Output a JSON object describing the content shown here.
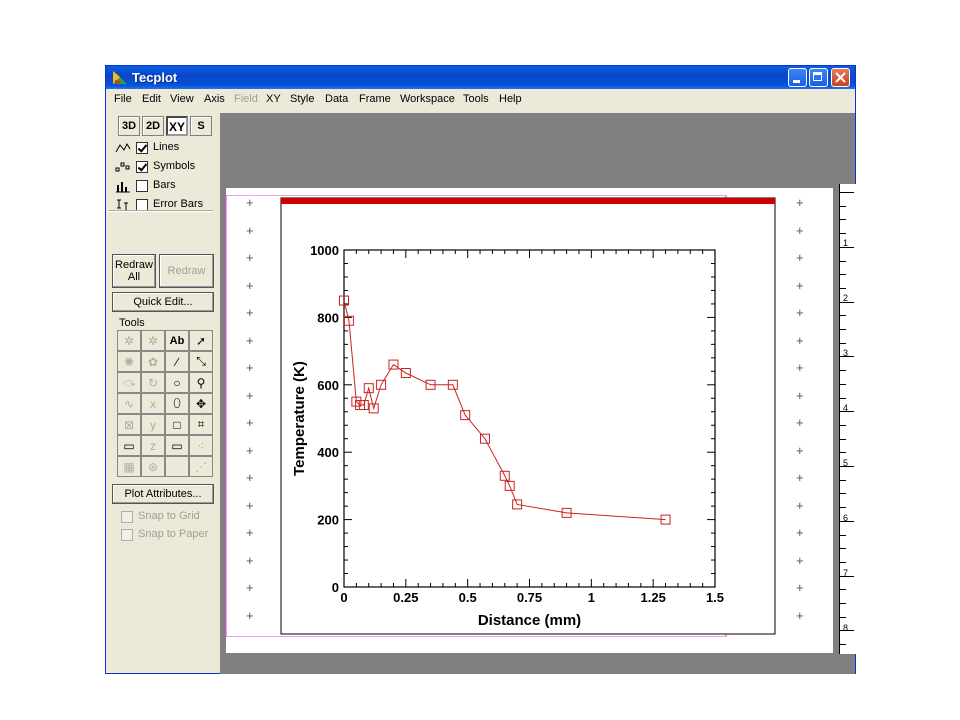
{
  "window": {
    "title": "Tecplot"
  },
  "menu": [
    {
      "label": "File",
      "enabled": true
    },
    {
      "label": "Edit",
      "enabled": true
    },
    {
      "label": "View",
      "enabled": true
    },
    {
      "label": "Axis",
      "enabled": true
    },
    {
      "label": "Field",
      "enabled": false
    },
    {
      "label": "XY",
      "enabled": true
    },
    {
      "label": "Style",
      "enabled": true
    },
    {
      "label": "Data",
      "enabled": true
    },
    {
      "label": "Frame",
      "enabled": true
    },
    {
      "label": "Workspace",
      "enabled": true
    },
    {
      "label": "Tools",
      "enabled": true
    },
    {
      "label": "Help",
      "enabled": true
    }
  ],
  "modes": [
    {
      "label": "3D",
      "active": false
    },
    {
      "label": "2D",
      "active": false
    },
    {
      "label": "XY",
      "active": true
    },
    {
      "label": "S",
      "active": false
    }
  ],
  "layers": [
    {
      "label": "Lines",
      "checked": true
    },
    {
      "label": "Symbols",
      "checked": true
    },
    {
      "label": "Bars",
      "checked": false
    },
    {
      "label": "Error Bars",
      "checked": false
    }
  ],
  "buttons": {
    "redraw_all": "Redraw All",
    "redraw": "Redraw",
    "quick_edit": "Quick Edit...",
    "plot_attributes": "Plot Attributes..."
  },
  "tools_label": "Tools",
  "tools": [
    {
      "glyph": "✲",
      "enabled": false
    },
    {
      "glyph": "✲",
      "enabled": false
    },
    {
      "glyph": "Ab",
      "enabled": true
    },
    {
      "glyph": "➚",
      "enabled": true
    },
    {
      "glyph": "✺",
      "enabled": false
    },
    {
      "glyph": "✿",
      "enabled": false
    },
    {
      "glyph": "∕",
      "enabled": true
    },
    {
      "glyph": "⤡",
      "enabled": true
    },
    {
      "glyph": "⤼",
      "enabled": false
    },
    {
      "glyph": "↻",
      "enabled": false
    },
    {
      "glyph": "○",
      "enabled": true
    },
    {
      "glyph": "⚲",
      "enabled": true
    },
    {
      "glyph": "∿",
      "enabled": false
    },
    {
      "glyph": "x",
      "enabled": false
    },
    {
      "glyph": "⬯",
      "enabled": true
    },
    {
      "glyph": "✥",
      "enabled": true
    },
    {
      "glyph": "⊠",
      "enabled": false
    },
    {
      "glyph": "y",
      "enabled": false
    },
    {
      "glyph": "□",
      "enabled": true
    },
    {
      "glyph": "⌗",
      "enabled": true
    },
    {
      "glyph": "▭",
      "enabled": true
    },
    {
      "glyph": "z",
      "enabled": false
    },
    {
      "glyph": "▭",
      "enabled": true
    },
    {
      "glyph": "⁖",
      "enabled": false
    },
    {
      "glyph": "▦",
      "enabled": false
    },
    {
      "glyph": "⊛",
      "enabled": false
    },
    {
      "glyph": "",
      "enabled": false
    },
    {
      "glyph": "⋰",
      "enabled": false
    }
  ],
  "snap": [
    {
      "label": "Snap to Grid"
    },
    {
      "label": "Snap to Paper"
    }
  ],
  "ruler_labels": [
    "1",
    "2",
    "3",
    "4",
    "5",
    "6",
    "7",
    "8"
  ],
  "colors": {
    "frame_header": "#cc0000",
    "series": "#cc2222",
    "paper_border": "#e040e0",
    "workspace": "#808080"
  },
  "chart_data": {
    "type": "line",
    "title": "",
    "xlabel": "Distance (mm)",
    "ylabel": "Temperature (K)",
    "xlim": [
      0,
      1.5
    ],
    "ylim": [
      0,
      1000
    ],
    "xticks": [
      0,
      0.25,
      0.5,
      0.75,
      1,
      1.25,
      1.5
    ],
    "xtick_labels": [
      "0",
      "0.25",
      "0.5",
      "0.75",
      "1",
      "1.25",
      "1.5"
    ],
    "yticks": [
      0,
      200,
      400,
      600,
      800,
      1000
    ],
    "ytick_labels": [
      "0",
      "200",
      "400",
      "600",
      "800",
      "1000"
    ],
    "grid": false,
    "marker": "square",
    "x": [
      0.0,
      0.02,
      0.05,
      0.065,
      0.08,
      0.1,
      0.12,
      0.15,
      0.2,
      0.25,
      0.35,
      0.44,
      0.49,
      0.57,
      0.65,
      0.67,
      0.7,
      0.9,
      1.3
    ],
    "y": [
      850,
      790,
      550,
      540,
      540,
      590,
      530,
      600,
      660,
      635,
      600,
      600,
      510,
      440,
      330,
      300,
      245,
      220,
      200
    ]
  }
}
